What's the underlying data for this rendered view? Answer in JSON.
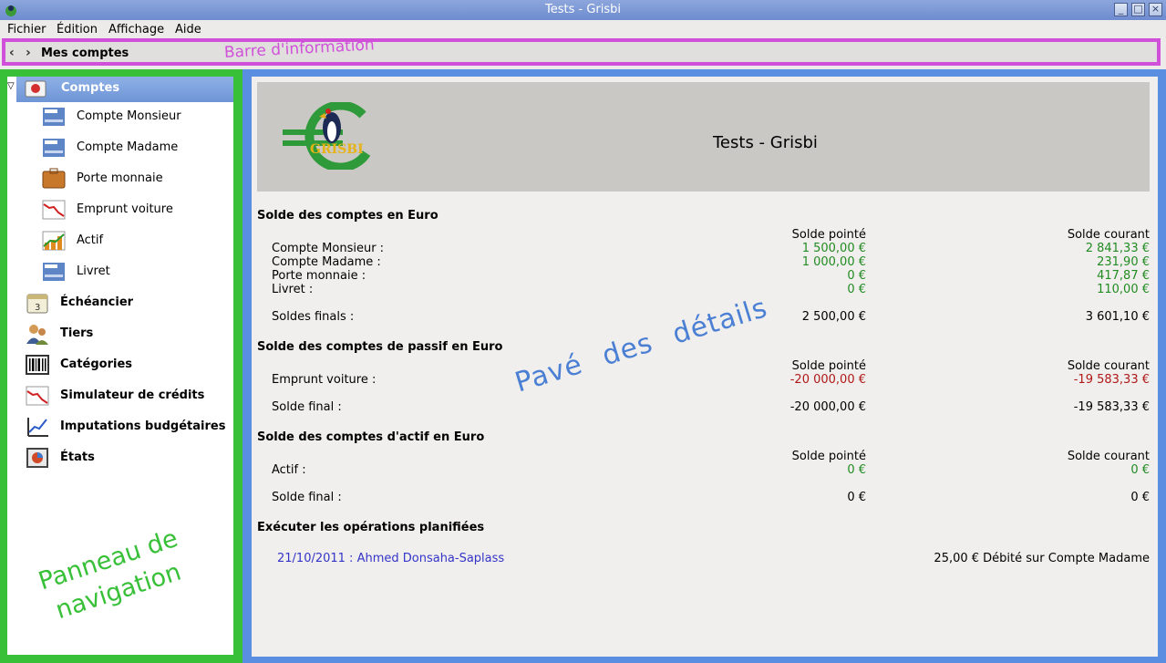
{
  "window": {
    "title": "Tests - Grisbi"
  },
  "menubar": {
    "items": [
      "Fichier",
      "Édition",
      "Affichage",
      "Aide"
    ]
  },
  "infobar": {
    "back": "‹",
    "forward": "›",
    "title": "Mes comptes",
    "annotation": "Barre d'information"
  },
  "nav": {
    "header": "Comptes",
    "accounts": [
      "Compte Monsieur",
      "Compte Madame",
      "Porte monnaie",
      "Emprunt voiture",
      "Actif",
      "Livret"
    ],
    "sections": [
      "Échéancier",
      "Tiers",
      "Catégories",
      "Simulateur de crédits",
      "Imputations budgétaires",
      "États"
    ],
    "annotation_line1": "Panneau de",
    "annotation_line2": "navigation"
  },
  "details": {
    "banner_title": "Tests - Grisbi",
    "annotation": "Pavé des détails",
    "euro_section": {
      "title": "Solde des comptes en Euro",
      "col1": "Solde pointé",
      "col2": "Solde courant",
      "rows": [
        {
          "name": "Compte Monsieur :",
          "pointe": "1 500,00 €",
          "courant": "2 841,33 €"
        },
        {
          "name": "Compte Madame :",
          "pointe": "1 000,00 €",
          "courant": "231,90 €"
        },
        {
          "name": "Porte monnaie :",
          "pointe": "0 €",
          "courant": "417,87 €"
        },
        {
          "name": "Livret :",
          "pointe": "0 €",
          "courant": "110,00 €"
        }
      ],
      "final": {
        "name": "Soldes finals :",
        "pointe": "2 500,00 €",
        "courant": "3 601,10 €"
      }
    },
    "passif_section": {
      "title": "Solde des comptes de passif en Euro",
      "col1": "Solde pointé",
      "col2": "Solde courant",
      "row": {
        "name": "Emprunt voiture :",
        "pointe": "-20 000,00 €",
        "courant": "-19 583,33 €"
      },
      "final": {
        "name": "Solde final :",
        "pointe": "-20 000,00 €",
        "courant": "-19 583,33 €"
      }
    },
    "actif_section": {
      "title": "Solde des comptes d'actif en Euro",
      "col1": "Solde pointé",
      "col2": "Solde courant",
      "row": {
        "name": "Actif :",
        "pointe": "0 €",
        "courant": "0 €"
      },
      "final": {
        "name": "Solde final :",
        "pointe": "0 €",
        "courant": "0 €"
      }
    },
    "scheduled": {
      "title": "Exécuter les opérations planifiées",
      "link": "21/10/2011 : Ahmed Donsaha-Saplass",
      "amount": "25,00 € Débité sur Compte Madame"
    }
  },
  "colors": {
    "nav_border": "#38c038",
    "details_border": "#5a8ee0",
    "infobar_border": "#d050d9",
    "positive": "#228b22",
    "negative": "#b01818",
    "link": "#3434c8"
  }
}
